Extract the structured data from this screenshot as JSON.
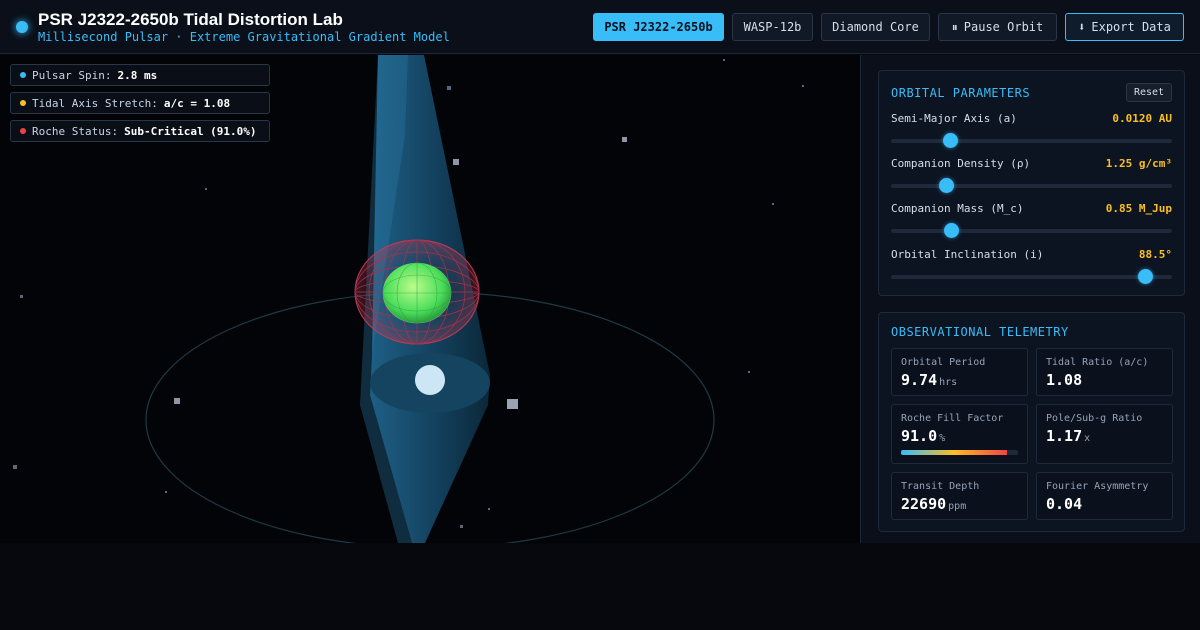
{
  "header": {
    "title": "PSR J2322-2650b Tidal Distortion Lab",
    "subtitle": "Millisecond Pulsar · Extreme Gravitational Gradient Model",
    "buttons": {
      "target_pulsar": "PSR J2322-2650b",
      "target_wasp": "WASP-12b",
      "target_diamond": "Diamond Core",
      "pause_icon": "⏸",
      "pause_label": "Pause Orbit",
      "export_icon": "⬇",
      "export_label": "Export Data"
    }
  },
  "overlay": {
    "pulsar_spin_label": "Pulsar Spin:",
    "pulsar_spin_value": "2.8 ms",
    "tidal_stretch_label": "Tidal Axis Stretch:",
    "tidal_stretch_value": "a/c = 1.08",
    "roche_status_label": "Roche Status:",
    "roche_status_value": "Sub-Critical (91.0%)"
  },
  "orbital": {
    "title": "ORBITAL PARAMETERS",
    "reset_label": "Reset",
    "params": [
      {
        "label": "Semi-Major Axis (a)",
        "value": "0.0120 AU",
        "fraction": 0.21
      },
      {
        "label": "Companion Density (ρ)",
        "value": "1.25 g/cm³",
        "fraction": 0.195
      },
      {
        "label": "Companion Mass (M_c)",
        "value": "0.85 M_Jup",
        "fraction": 0.215
      },
      {
        "label": "Orbital Inclination (i)",
        "value": "88.5°",
        "fraction": 0.905
      }
    ]
  },
  "telemetry": {
    "title": "OBSERVATIONAL TELEMETRY",
    "orbital_period": {
      "label": "Orbital Period",
      "value": "9.74",
      "unit": "hrs"
    },
    "tidal_ratio": {
      "label": "Tidal Ratio (a/c)",
      "value": "1.08"
    },
    "roche_fill": {
      "label": "Roche Fill Factor",
      "value": "91.0",
      "unit": "%",
      "fraction": 0.91
    },
    "pole_ratio": {
      "label": "Pole/Sub-g Ratio",
      "value": "1.17",
      "unit": "x"
    },
    "transit_depth": {
      "label": "Transit Depth",
      "value": "22690",
      "unit": "ppm"
    },
    "fourier": {
      "label": "Fourier Asymmetry",
      "value": "0.04"
    }
  },
  "colors": {
    "accent": "#38bdf8",
    "value": "#fbbf24",
    "spin_dot": "#38bdf8",
    "stretch_dot": "#fbbf24",
    "roche_dot": "#ef4444"
  }
}
